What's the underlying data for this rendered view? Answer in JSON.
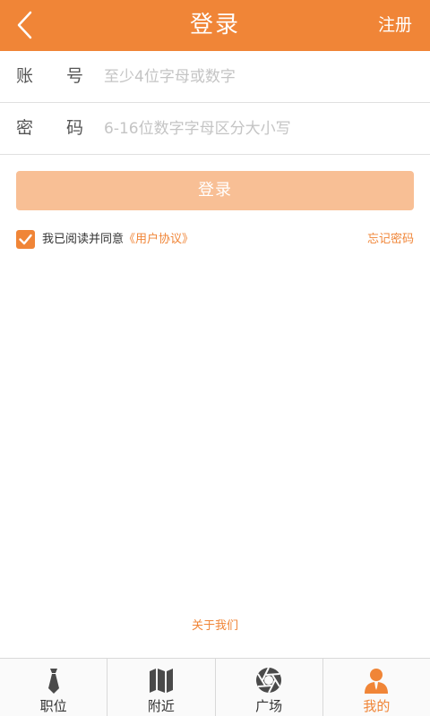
{
  "header": {
    "title": "登录",
    "register_label": "注册",
    "back_icon": "chevron-left-icon"
  },
  "form": {
    "account": {
      "label_chars": [
        "账",
        "号"
      ],
      "placeholder": "至少4位字母或数字"
    },
    "password": {
      "label_chars": [
        "密",
        "码"
      ],
      "placeholder": "6-16位数字字母区分大小写"
    }
  },
  "login_button": {
    "label": "登录"
  },
  "agreement": {
    "checked": true,
    "text": "我已阅读并同意",
    "link_text": "《用户协议》"
  },
  "forgot_password": "忘记密码",
  "about_us": "关于我们",
  "bottom_nav": {
    "items": [
      {
        "label": "职位",
        "icon": "tie-icon",
        "active": false
      },
      {
        "label": "附近",
        "icon": "map-icon",
        "active": false
      },
      {
        "label": "广场",
        "icon": "aperture-icon",
        "active": false
      },
      {
        "label": "我的",
        "icon": "user-icon",
        "active": true
      }
    ]
  },
  "colors": {
    "accent": "#f08537",
    "login_button_bg": "#f8bf95",
    "inactive_icon": "#4a4a4a"
  }
}
